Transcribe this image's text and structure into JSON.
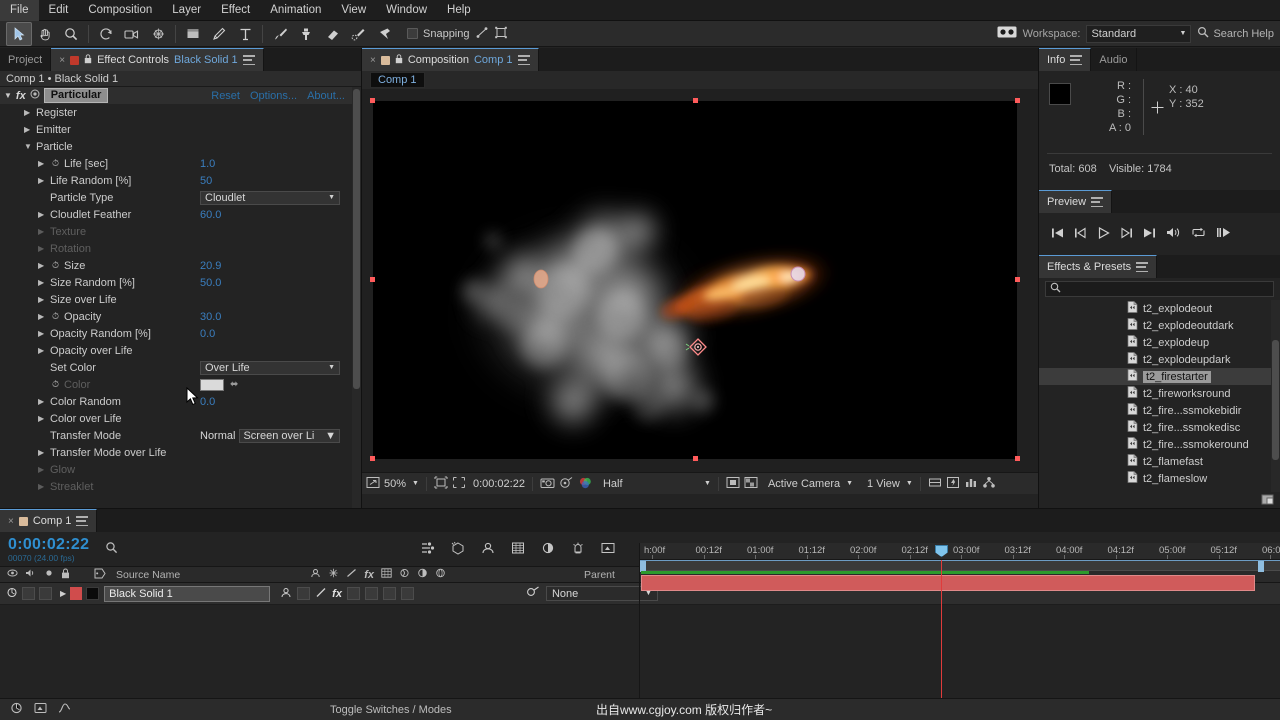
{
  "menu": {
    "items": [
      "File",
      "Edit",
      "Composition",
      "Layer",
      "Effect",
      "Animation",
      "View",
      "Window",
      "Help"
    ]
  },
  "toolbar": {
    "tools": [
      "selection-tool",
      "hand-tool",
      "zoom-tool",
      "rotation-tool",
      "camera-tool",
      "pan-behind-tool",
      "shape-tool",
      "pen-tool",
      "type-tool",
      "brush-tool",
      "clone-stamp-tool",
      "eraser-tool",
      "roto-brush-tool",
      "puppet-pin-tool"
    ],
    "snapping_label": "Snapping",
    "workspace_label": "Workspace:",
    "workspace_value": "Standard",
    "search_help_placeholder": "Search Help"
  },
  "effect_controls": {
    "tab_project": "Project",
    "tab_title": "Effect Controls",
    "tab_subject": "Black Solid 1",
    "breadcrumb": "Comp 1 • Black Solid 1",
    "effect_name": "Particular",
    "links": [
      "Reset",
      "Options...",
      "About..."
    ],
    "rows": [
      {
        "label": "Register",
        "indent": 1,
        "twirl": "closed",
        "value": "",
        "kind": "group"
      },
      {
        "label": "Emitter",
        "indent": 1,
        "twirl": "closed",
        "value": "",
        "kind": "group"
      },
      {
        "label": "Particle",
        "indent": 1,
        "twirl": "open",
        "value": "",
        "kind": "group"
      },
      {
        "label": "Life [sec]",
        "indent": 2,
        "twirl": "closed",
        "stopwatch": true,
        "value": "1.0",
        "kind": "num"
      },
      {
        "label": "Life Random [%]",
        "indent": 2,
        "twirl": "closed",
        "value": "50",
        "kind": "num"
      },
      {
        "label": "Particle Type",
        "indent": 2,
        "twirl": "none",
        "value": "Cloudlet",
        "kind": "dropdown"
      },
      {
        "label": "Cloudlet Feather",
        "indent": 2,
        "twirl": "closed",
        "value": "60.0",
        "kind": "num"
      },
      {
        "label": "Texture",
        "indent": 2,
        "twirl": "closed",
        "value": "",
        "kind": "group",
        "disabled": true
      },
      {
        "label": "Rotation",
        "indent": 2,
        "twirl": "closed",
        "value": "",
        "kind": "group",
        "disabled": true
      },
      {
        "label": "Size",
        "indent": 2,
        "twirl": "closed",
        "stopwatch": true,
        "value": "20.9",
        "kind": "num"
      },
      {
        "label": "Size Random [%]",
        "indent": 2,
        "twirl": "closed",
        "value": "50.0",
        "kind": "num"
      },
      {
        "label": "Size over Life",
        "indent": 2,
        "twirl": "closed",
        "value": "",
        "kind": "group"
      },
      {
        "label": "Opacity",
        "indent": 2,
        "twirl": "closed",
        "stopwatch": true,
        "value": "30.0",
        "kind": "num"
      },
      {
        "label": "Opacity Random [%]",
        "indent": 2,
        "twirl": "closed",
        "value": "0.0",
        "kind": "num"
      },
      {
        "label": "Opacity over Life",
        "indent": 2,
        "twirl": "closed",
        "value": "",
        "kind": "group"
      },
      {
        "label": "Set Color",
        "indent": 2,
        "twirl": "none",
        "value": "Over Life",
        "kind": "dropdown"
      },
      {
        "label": "Color",
        "indent": 2,
        "twirl": "none",
        "stopwatch": true,
        "value": "",
        "kind": "color",
        "disabled": true,
        "color": "#dadada"
      },
      {
        "label": "Color Random",
        "indent": 2,
        "twirl": "closed",
        "value": "0.0",
        "kind": "num"
      },
      {
        "label": "Color over Life",
        "indent": 2,
        "twirl": "closed",
        "value": "",
        "kind": "group"
      },
      {
        "label": "Transfer Mode",
        "indent": 2,
        "twirl": "none",
        "value": "Screen over Li",
        "value2": "Normal",
        "kind": "dual"
      },
      {
        "label": "Transfer Mode over Life",
        "indent": 2,
        "twirl": "closed",
        "value": "",
        "kind": "group"
      },
      {
        "label": "Glow",
        "indent": 2,
        "twirl": "closed",
        "value": "",
        "kind": "group",
        "disabled": true
      },
      {
        "label": "Streaklet",
        "indent": 2,
        "twirl": "closed",
        "value": "",
        "kind": "group",
        "disabled": true
      }
    ]
  },
  "composition": {
    "tab_title": "Composition",
    "tab_subject": "Comp 1",
    "crumb": "Comp 1",
    "toolbar": {
      "zoom": "50%",
      "timecode": "0:00:02:22",
      "resolution": "Half",
      "camera": "Active Camera",
      "views": "1 View"
    }
  },
  "info": {
    "tab_info": "Info",
    "tab_audio": "Audio",
    "r_label": "R :",
    "r_value": "",
    "g_label": "G :",
    "g_value": "",
    "b_label": "B :",
    "b_value": "",
    "a_label": "A :",
    "a_value": "0",
    "x_label": "X :",
    "x_value": "40",
    "y_label": "Y :",
    "y_value": "352",
    "total_label": "Total:",
    "total_value": "608",
    "visible_label": "Visible:",
    "visible_value": "1784"
  },
  "preview": {
    "tab_title": "Preview",
    "buttons": [
      "first-frame-button",
      "previous-frame-button",
      "play-button",
      "next-frame-button",
      "last-frame-button",
      "audio-toggle-button",
      "loop-button",
      "ram-preview-button"
    ]
  },
  "effects_presets": {
    "tab_title": "Effects & Presets",
    "search_placeholder": "",
    "items": [
      {
        "name": "t2_explodeout",
        "selected": false
      },
      {
        "name": "t2_explodeoutdark",
        "selected": false
      },
      {
        "name": "t2_explodeup",
        "selected": false
      },
      {
        "name": "t2_explodeupdark",
        "selected": false
      },
      {
        "name": "t2_firestarter",
        "selected": true
      },
      {
        "name": "t2_fireworksround",
        "selected": false
      },
      {
        "name": "t2_fire...ssmokebidir",
        "selected": false
      },
      {
        "name": "t2_fire...ssmokedisc",
        "selected": false
      },
      {
        "name": "t2_fire...ssmokeround",
        "selected": false
      },
      {
        "name": "t2_flamefast",
        "selected": false
      },
      {
        "name": "t2_flameslow",
        "selected": false
      }
    ]
  },
  "timeline": {
    "tab_title": "Comp 1",
    "current_time": "0:00:02:22",
    "current_frame": "00070 (24.00 fps)",
    "columns": {
      "source_name": "Source Name",
      "parent": "Parent"
    },
    "layer": {
      "name": "Black Solid 1",
      "parent_value": "None"
    },
    "ruler_ticks": [
      "h:00f",
      "00:12f",
      "01:00f",
      "01:12f",
      "02:00f",
      "02:12f",
      "03:00f",
      "03:12f",
      "04:00f",
      "04:12f",
      "05:00f",
      "05:12f",
      "06:0"
    ]
  },
  "status": {
    "toggle_label": "Toggle Switches / Modes",
    "watermark": "出自www.cgjoy.com 版权归作者~"
  },
  "colors": {
    "accent_blue": "#3a7ebf",
    "highlight_blue": "#6fa8dc",
    "layer_red": "#d05b5b",
    "work_green": "#2d9a2d",
    "cti_red": "#e03b3b"
  }
}
